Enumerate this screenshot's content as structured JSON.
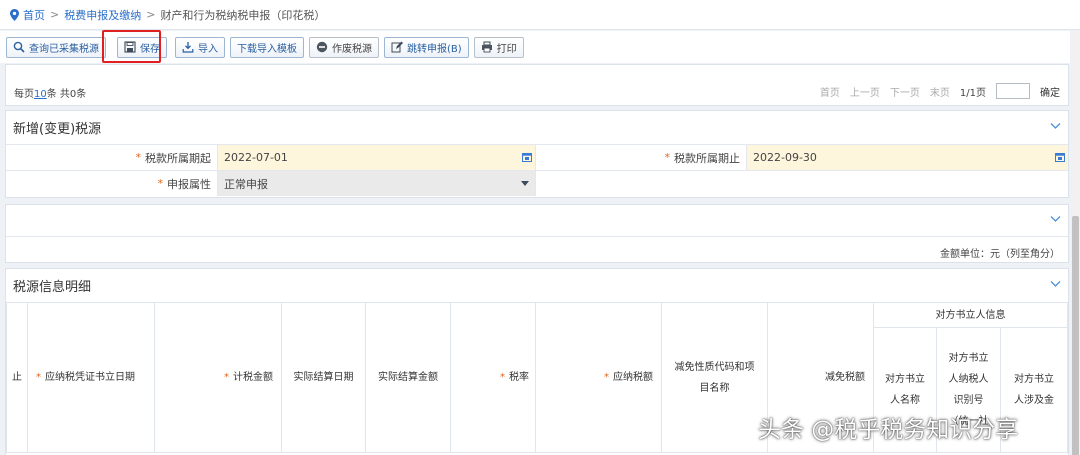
{
  "breadcrumb": {
    "home": "首页",
    "section": "税费申报及缴纳",
    "current": "财产和行为税纳税申报（印花税）"
  },
  "toolbar": {
    "query_label": "查询已采集税源",
    "save_label": "保存",
    "import_label": "导入",
    "download_template_label": "下载导入模板",
    "void_label": "作废税源",
    "jump_label": "跳转申报(B)",
    "print_label": "打印"
  },
  "pager": {
    "per_page_prefix": "每页",
    "per_page_value": "10",
    "per_page_suffix": "条 共0条",
    "first": "首页",
    "prev": "上一页",
    "next": "下一页",
    "last": "末页",
    "page_info": "1/1页",
    "page_input": "",
    "go": "确定"
  },
  "new_source": {
    "title": "新增(变更)税源",
    "period_start_label": "税款所属期起",
    "period_start_value": "2022-07-01",
    "period_end_label": "税款所属期止",
    "period_end_value": "2022-09-30",
    "attr_label": "申报属性",
    "attr_value": "正常申报"
  },
  "amount_unit": "金额单位：元（列至角分）",
  "detail": {
    "title": "税源信息明细",
    "columns": [
      {
        "label": "止",
        "required": false
      },
      {
        "label": "应纳税凭证书立日期",
        "required": true
      },
      {
        "label": "计税金额",
        "required": true
      },
      {
        "label": "实际结算日期",
        "required": false
      },
      {
        "label": "实际结算金额",
        "required": false
      },
      {
        "label": "税率",
        "required": true
      },
      {
        "label": "应纳税额",
        "required": true
      },
      {
        "label": "减免性质代码和项目名称",
        "required": false
      },
      {
        "label": "减免税额",
        "required": false
      }
    ],
    "group_header": "对方书立人信息",
    "sub_columns": [
      "对方书立人名称",
      "对方书立人纳税人识别号（统一社",
      "对方书立人涉及金"
    ]
  },
  "watermark": "头条 @税乎税务知识分享",
  "colors": {
    "accent": "#2a6fc9",
    "required_mark": "#e0681d",
    "highlight_box": "#e02020",
    "input_bg": "#fdf6dc"
  }
}
